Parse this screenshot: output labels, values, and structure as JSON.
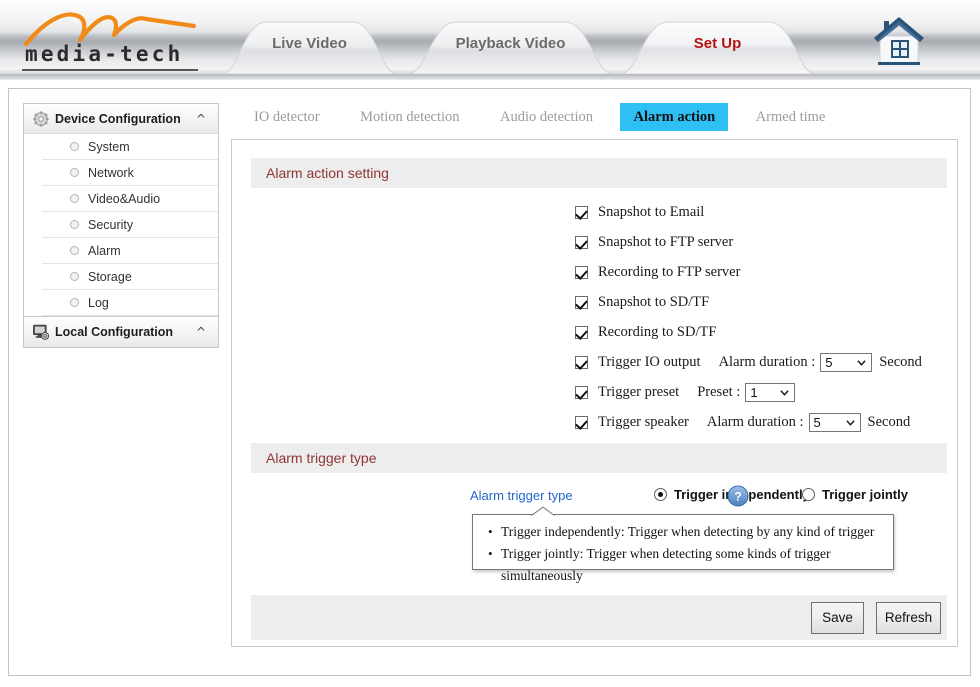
{
  "header": {
    "brand": "media-tech",
    "brand_logo_icon": "swoosh-logo",
    "home_icon": "house-icon",
    "tabs": [
      {
        "label": "Live Video",
        "active": false
      },
      {
        "label": "Playback Video",
        "active": false
      },
      {
        "label": "Set Up",
        "active": true
      }
    ]
  },
  "sidebar": {
    "groups": [
      {
        "label": "Device Configuration",
        "icon": "gear-icon",
        "caret": "^",
        "items": [
          {
            "label": "System"
          },
          {
            "label": "Network"
          },
          {
            "label": "Video&Audio"
          },
          {
            "label": "Security"
          },
          {
            "label": "Alarm"
          },
          {
            "label": "Storage"
          },
          {
            "label": "Log"
          }
        ]
      },
      {
        "label": "Local Configuration",
        "icon": "monitor-gear-icon",
        "caret": "^",
        "items": []
      }
    ]
  },
  "subtabs": [
    {
      "label": "IO detector",
      "active": false
    },
    {
      "label": "Motion detection",
      "active": false
    },
    {
      "label": "Audio detection",
      "active": false
    },
    {
      "label": "Alarm action",
      "active": true
    },
    {
      "label": "Armed time",
      "active": false
    }
  ],
  "alarm_action": {
    "section_title": "Alarm action setting",
    "rows": [
      {
        "label": "Snapshot to Email",
        "checked": true
      },
      {
        "label": "Snapshot to FTP server",
        "checked": true
      },
      {
        "label": "Recording to FTP server",
        "checked": true
      },
      {
        "label": "Snapshot to SD/TF",
        "checked": true
      },
      {
        "label": "Recording to SD/TF",
        "checked": true
      },
      {
        "label": "Trigger IO output",
        "checked": true,
        "sub_label": "Alarm duration :",
        "value": "5",
        "unit": "Second"
      },
      {
        "label": "Trigger preset",
        "checked": true,
        "sub_label": "Preset :",
        "value": "1",
        "unit": ""
      },
      {
        "label": "Trigger speaker",
        "checked": true,
        "sub_label": "Alarm duration :",
        "value": "5",
        "unit": "Second"
      }
    ]
  },
  "alarm_trigger": {
    "section_title": "Alarm trigger type",
    "field_label": "Alarm trigger type",
    "options": [
      {
        "label": "Trigger independently",
        "selected": true
      },
      {
        "label": "Trigger jointly",
        "selected": false
      }
    ],
    "help_icon": "question-mark-icon",
    "tooltip": {
      "line1": "Trigger independently: Trigger when detecting by any kind of trigger",
      "line2": "Trigger jointly: Trigger when detecting some kinds of trigger simultaneously"
    }
  },
  "footer": {
    "save_label": "Save",
    "refresh_label": "Refresh"
  },
  "colors": {
    "accent_tab": "#2ec0f5",
    "section_title": "#8f3535",
    "link": "#2266cc",
    "active_nav": "#b81414"
  }
}
